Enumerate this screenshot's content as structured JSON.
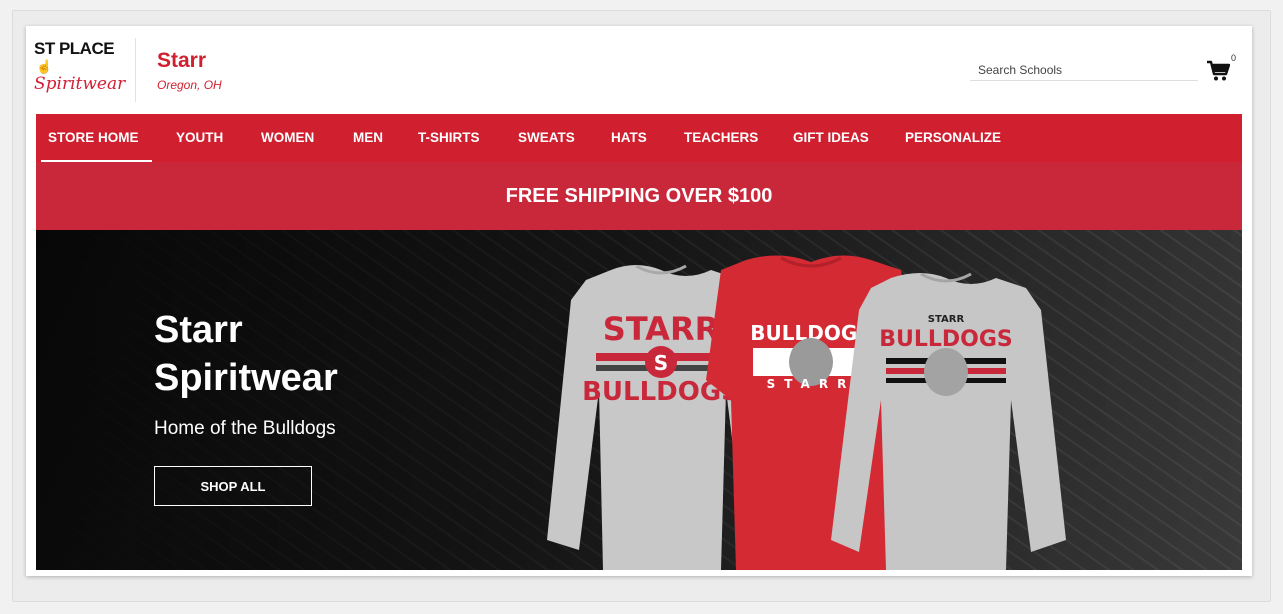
{
  "brand": {
    "logo_top": "ST PLACE",
    "logo_bottom": "Spiritwear"
  },
  "school": {
    "name": "Starr",
    "location": "Oregon, OH"
  },
  "search": {
    "placeholder": "Search Schools"
  },
  "cart": {
    "count": "0",
    "icon": "cart-icon"
  },
  "nav": {
    "items": [
      {
        "label": "STORE HOME",
        "active": true
      },
      {
        "label": "YOUTH"
      },
      {
        "label": "WOMEN"
      },
      {
        "label": "MEN"
      },
      {
        "label": "T-SHIRTS"
      },
      {
        "label": "SWEATS"
      },
      {
        "label": "HATS"
      },
      {
        "label": "TEACHERS"
      },
      {
        "label": "GIFT IDEAS"
      },
      {
        "label": "PERSONALIZE"
      }
    ]
  },
  "promo": {
    "text": "FREE SHIPPING OVER $100"
  },
  "hero": {
    "title_line1": "Starr",
    "title_line2": "Spiritwear",
    "subtitle": "Home of the Bulldogs",
    "cta": "SHOP ALL",
    "shirt_left": {
      "top": "STARR",
      "middle": "S",
      "bottom": "BULLDOGS"
    },
    "shirt_center": {
      "top": "BULLDOGS",
      "bottom": "STARR"
    },
    "shirt_right": {
      "top": "STARR",
      "middle": "BULLDOGS"
    }
  },
  "colors": {
    "brand_red": "#d0202f",
    "promo_red": "#c9283a",
    "hero_dark": "#141414",
    "shirt_gray": "#c9c9c9"
  }
}
